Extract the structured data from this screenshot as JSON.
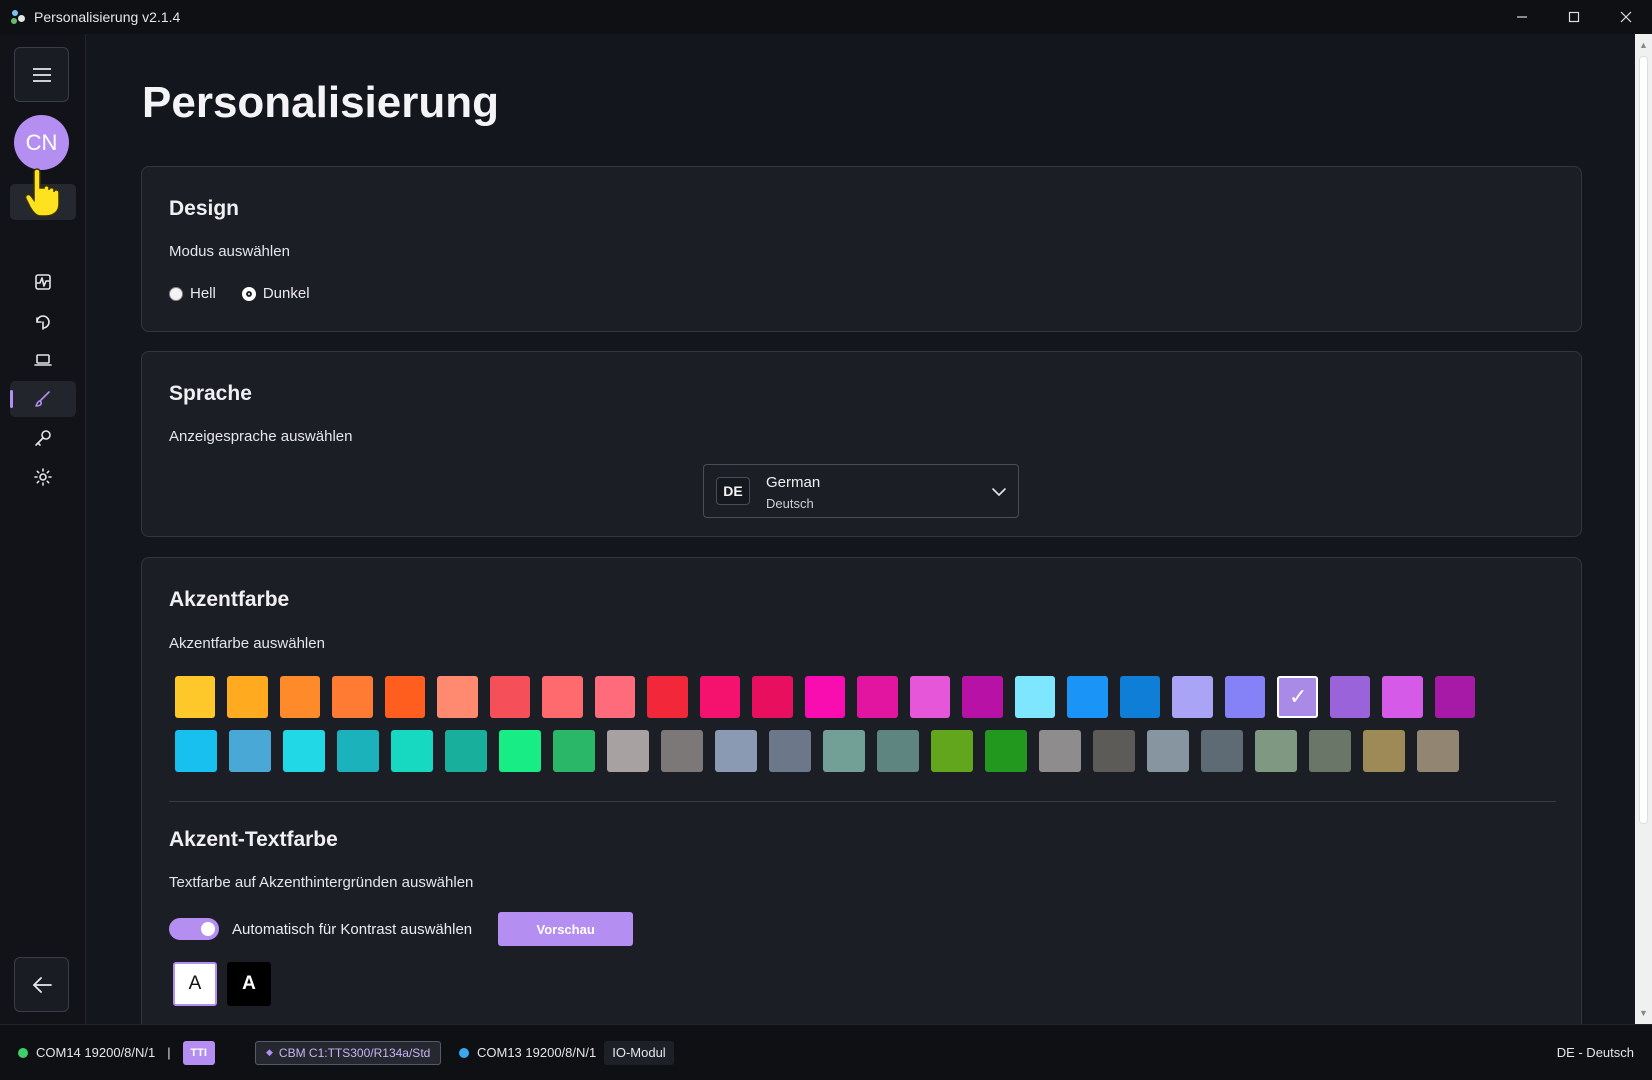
{
  "window": {
    "title": "Personalisierung v2.1.4",
    "controls": [
      "minimize-icon",
      "maximize-icon",
      "close-icon"
    ]
  },
  "sidebar": {
    "avatar_initials": "CN",
    "nav_icons": [
      "home-icon",
      "activity-icon",
      "refresh-wrench-icon",
      "laptop-icon",
      "brush-icon",
      "key-icon",
      "gear-icon"
    ],
    "active_item": "brush-icon"
  },
  "page": {
    "title": "Personalisierung"
  },
  "design": {
    "title": "Design",
    "subtitle": "Modus auswählen",
    "options": [
      {
        "label": "Hell",
        "checked": false
      },
      {
        "label": "Dunkel",
        "checked": true
      }
    ]
  },
  "language": {
    "title": "Sprache",
    "subtitle": "Anzeigesprache auswählen",
    "selected_code": "DE",
    "selected_name": "German",
    "selected_native": "Deutsch"
  },
  "accent": {
    "title": "Akzentfarbe",
    "subtitle": "Akzentfarbe auswählen",
    "selected_index": 21,
    "check_mark": "✓",
    "row1": [
      "#ffc82a",
      "#ffaa1f",
      "#ff8a2a",
      "#ff7a33",
      "#ff5e1f",
      "#ff8a70",
      "#f5505a",
      "#ff6a6f",
      "#ff6b7a",
      "#f2283a",
      "#f4126e",
      "#e8105e",
      "#f90db0",
      "#e215a0",
      "#e656d8",
      "#b811a6",
      "#7ee6ff",
      "#1a95f7",
      "#0f7ed6",
      "#a9a4f5",
      "#8582f7",
      "#a98ae6",
      "#9a63d9",
      "#d65ae8",
      "#a71aa8"
    ],
    "row2": [
      "#18c0f0",
      "#4aa8d6",
      "#20d8e6",
      "#1bb2bc",
      "#17d8c0",
      "#18b09c",
      "#18ec84",
      "#2ab767",
      "#a7a1a1",
      "#7c7878",
      "#8a9ab2",
      "#6c7789",
      "#72a096",
      "#5f8580",
      "#62a61d",
      "#22981e",
      "#8e8c8c",
      "#5d5b58",
      "#8795a0",
      "#5e6b75",
      "#7f9882",
      "#6a7668",
      "#9d8a56",
      "#928572"
    ]
  },
  "accent_text": {
    "title": "Akzent-Textfarbe",
    "subtitle": "Textfarbe auf Akzenthintergründen auswählen",
    "toggle_label": "Automatisch für Kontrast auswählen",
    "toggle_on": true,
    "preview_label": "Vorschau",
    "option_white": "A",
    "option_black": "A"
  },
  "statusbar": {
    "port1": "COM14 19200/8/N/1",
    "separator": "|",
    "chip1": "TTI",
    "chip2": "CBM C1:TTS300/R134a/Std",
    "port2": "COM13 19200/8/N/1",
    "chip3": "IO-Modul",
    "language": "DE - Deutsch",
    "port1_color": "#3fcf6a",
    "port2_color": "#3aa8f0"
  },
  "colors": {
    "accent": "#b48ef0",
    "background": "#14161d",
    "card": "#1c1e26"
  }
}
